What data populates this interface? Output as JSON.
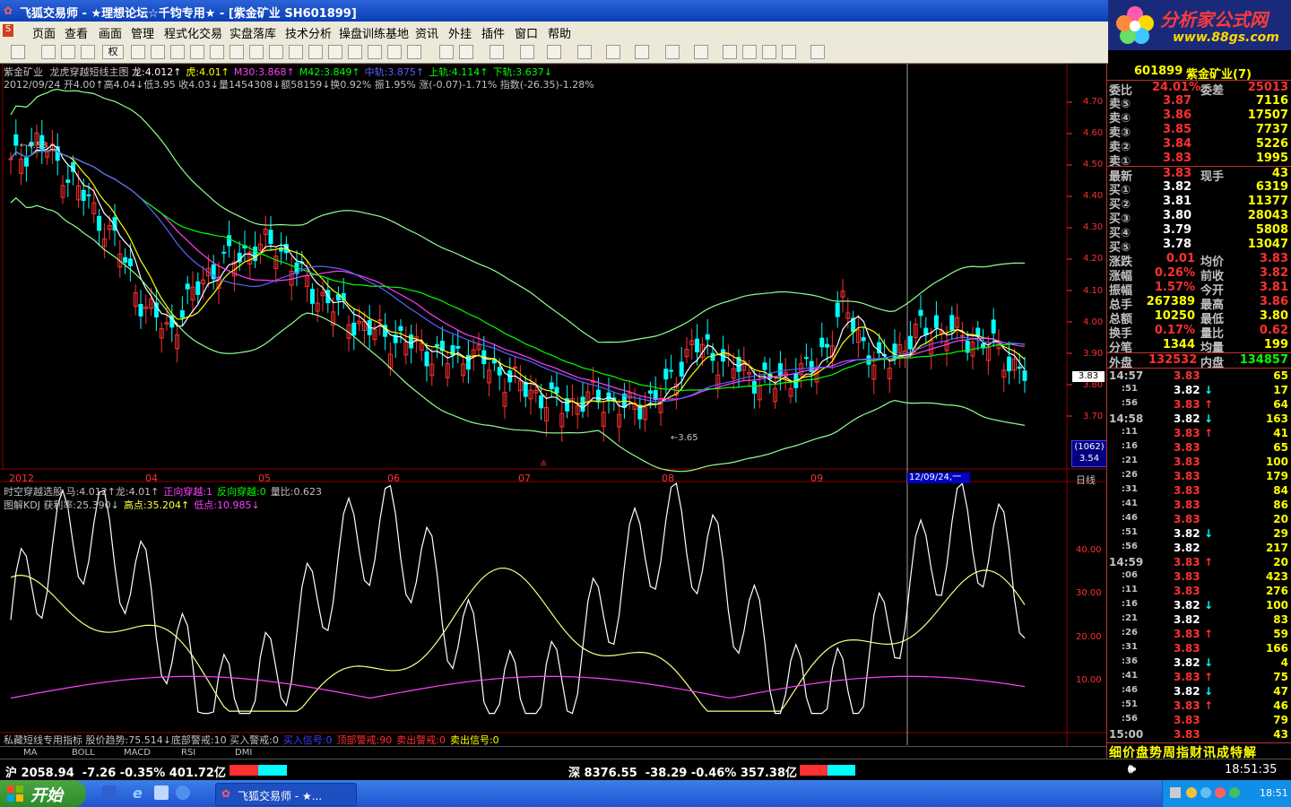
{
  "window": {
    "title": "飞狐交易师 - ★理想论坛☆千钧专用★ - [紫金矿业  SH601899]",
    "logo_text": "分析家公式网",
    "logo_url": "www.88gs.com"
  },
  "menu": [
    "页面",
    "查看",
    "画面",
    "管理",
    "程式化交易",
    "实盘落库",
    "技术分析",
    "操盘训练基地",
    "资讯",
    "外挂",
    "插件",
    "窗口",
    "帮助"
  ],
  "toolbar": {
    "right_mode": "权"
  },
  "chart": {
    "header1": {
      "name": "紫金矿业",
      "indicator": "龙虎穿越短线主图",
      "parts": [
        {
          "text": "龙:4.012↑",
          "color": "#ffffff"
        },
        {
          "text": "虎:4.01↑",
          "color": "#ffff00"
        },
        {
          "text": "M30:3.868↑",
          "color": "#ff40ff"
        },
        {
          "text": "M42:3.849↑",
          "color": "#00ff00"
        },
        {
          "text": "中轨:3.875↑",
          "color": "#6060ff"
        },
        {
          "text": "上轨:4.114↑",
          "color": "#00ff00"
        },
        {
          "text": "下轨:3.637↓",
          "color": "#00ff00"
        }
      ]
    },
    "header2": "2012/09/24 开4.00↑高4.04↓低3.95 收4.03↓量1454308↓额58159↓换0.92% 振1.95% 涨(-0.07)-1.71% 指数(-26.35)-1.28%",
    "price_axis": [
      "4.70",
      "4.60",
      "4.50",
      "4.40",
      "4.30",
      "4.20",
      "4.10",
      "4.00",
      "3.90",
      "3.80",
      "3.70"
    ],
    "current_price_tag": "3.83",
    "high_mark": "4.58",
    "low_mark": "3.65",
    "volume_box": [
      "(1062)",
      "3.54"
    ],
    "date_axis": [
      "2012",
      "04",
      "05",
      "06",
      "07",
      "08",
      "09"
    ],
    "cursor_date": "12/09/24,一",
    "period": "日线",
    "sub_header1": [
      {
        "text": "时空穿越选股  马:4.012↑龙:4.01↑",
        "color": "#c0c0c0"
      },
      {
        "text": "正向穿越:1",
        "color": "#ff40ff"
      },
      {
        "text": "反向穿越:0",
        "color": "#00ff00"
      },
      {
        "text": "量比:0.623",
        "color": "#c0c0c0"
      }
    ],
    "sub_header2": [
      {
        "text": "图解KDJ  获利率:25.390↓",
        "color": "#c0c0c0"
      },
      {
        "text": "高点:35.204↑",
        "color": "#ffff40"
      },
      {
        "text": "低点:10.985↓",
        "color": "#ff40ff"
      }
    ],
    "sub_axis": [
      "40.00",
      "30.00",
      "20.00",
      "10.00"
    ],
    "bottom_header": [
      {
        "text": "私藏短线专用指标  股价趋势:75.514↓底部警戒:10  买入警戒:0",
        "color": "#c0c0c0"
      },
      {
        "text": "买入信号:0",
        "color": "#4040ff"
      },
      {
        "text": "顶部警戒:90",
        "color": "#ff3030"
      },
      {
        "text": "卖出警戒:0",
        "color": "#ff3030"
      },
      {
        "text": "卖出信号:0",
        "color": "#ffff00"
      }
    ],
    "tabs": [
      "MA",
      "BOLL",
      "MACD",
      "RSI",
      "DMI"
    ]
  },
  "quote": {
    "code": "601899",
    "name": "紫金矿业(7)",
    "webi_label": "委比",
    "webi": "24.01%",
    "weicha_label": "委差",
    "weicha": "25013",
    "sells": [
      {
        "label": "卖⑤",
        "price": "3.87",
        "vol": "7116"
      },
      {
        "label": "卖④",
        "price": "3.86",
        "vol": "17507"
      },
      {
        "label": "卖③",
        "price": "3.85",
        "vol": "7737"
      },
      {
        "label": "卖②",
        "price": "3.84",
        "vol": "5226"
      },
      {
        "label": "卖①",
        "price": "3.83",
        "vol": "1995"
      }
    ],
    "latest_label": "最新",
    "latest": "3.83",
    "xianshou_label": "现手",
    "xianshou": "43",
    "buys": [
      {
        "label": "买①",
        "price": "3.82",
        "vol": "6319"
      },
      {
        "label": "买②",
        "price": "3.81",
        "vol": "11377"
      },
      {
        "label": "买③",
        "price": "3.80",
        "vol": "28043"
      },
      {
        "label": "买④",
        "price": "3.79",
        "vol": "5808"
      },
      {
        "label": "买⑤",
        "price": "3.78",
        "vol": "13047"
      }
    ],
    "stats": [
      [
        "涨跌",
        "0.01",
        "均价",
        "3.83"
      ],
      [
        "涨幅",
        "0.26%",
        "前收",
        "3.82"
      ],
      [
        "振幅",
        "1.57%",
        "今开",
        "3.81"
      ],
      [
        "总手",
        "267389",
        "最高",
        "3.86"
      ],
      [
        "总额",
        "10250",
        "最低",
        "3.80"
      ],
      [
        "换手",
        "0.17%",
        "量比",
        "0.62"
      ],
      [
        "分笔",
        "1344",
        "均量",
        "199"
      ]
    ],
    "waipan_label": "外盘",
    "waipan": "132532",
    "neipan_label": "内盘",
    "neipan": "134857",
    "ticks": [
      {
        "t": "14:57",
        "p": "3.83",
        "a": "",
        "v": "65",
        "c": "r"
      },
      {
        "t": ":51",
        "p": "3.82",
        "a": "↓",
        "v": "17",
        "c": "w"
      },
      {
        "t": ":56",
        "p": "3.83",
        "a": "↑",
        "v": "64",
        "c": "r"
      },
      {
        "t": "14:58",
        "p": "3.82",
        "a": "↓",
        "v": "163",
        "c": "w"
      },
      {
        "t": ":11",
        "p": "3.83",
        "a": "↑",
        "v": "41",
        "c": "r"
      },
      {
        "t": ":16",
        "p": "3.83",
        "a": "",
        "v": "65",
        "c": "r"
      },
      {
        "t": ":21",
        "p": "3.83",
        "a": "",
        "v": "100",
        "c": "r"
      },
      {
        "t": ":26",
        "p": "3.83",
        "a": "",
        "v": "179",
        "c": "r"
      },
      {
        "t": ":31",
        "p": "3.83",
        "a": "",
        "v": "84",
        "c": "r"
      },
      {
        "t": ":41",
        "p": "3.83",
        "a": "",
        "v": "86",
        "c": "r"
      },
      {
        "t": ":46",
        "p": "3.83",
        "a": "",
        "v": "20",
        "c": "r"
      },
      {
        "t": ":51",
        "p": "3.82",
        "a": "↓",
        "v": "29",
        "c": "w"
      },
      {
        "t": ":56",
        "p": "3.82",
        "a": "",
        "v": "217",
        "c": "w"
      },
      {
        "t": "14:59",
        "p": "3.83",
        "a": "↑",
        "v": "20",
        "c": "r"
      },
      {
        "t": ":06",
        "p": "3.83",
        "a": "",
        "v": "423",
        "c": "r"
      },
      {
        "t": ":11",
        "p": "3.83",
        "a": "",
        "v": "276",
        "c": "r"
      },
      {
        "t": ":16",
        "p": "3.82",
        "a": "↓",
        "v": "100",
        "c": "w"
      },
      {
        "t": ":21",
        "p": "3.82",
        "a": "",
        "v": "83",
        "c": "w"
      },
      {
        "t": ":26",
        "p": "3.83",
        "a": "↑",
        "v": "59",
        "c": "r"
      },
      {
        "t": ":31",
        "p": "3.83",
        "a": "",
        "v": "166",
        "c": "r"
      },
      {
        "t": ":36",
        "p": "3.82",
        "a": "↓",
        "v": "4",
        "c": "w"
      },
      {
        "t": ":41",
        "p": "3.83",
        "a": "↑",
        "v": "75",
        "c": "r"
      },
      {
        "t": ":46",
        "p": "3.82",
        "a": "↓",
        "v": "47",
        "c": "w"
      },
      {
        "t": ":51",
        "p": "3.83",
        "a": "↑",
        "v": "46",
        "c": "r"
      },
      {
        "t": ":56",
        "p": "3.83",
        "a": "",
        "v": "79",
        "c": "r"
      },
      {
        "t": "15:00",
        "p": "3.83",
        "a": "",
        "v": "43",
        "c": "r"
      }
    ],
    "bottom_tabs": "细价盘势周指财讯成特解"
  },
  "status": {
    "sh": "沪 2058.94  -7.26 -0.35% 401.72亿",
    "sz": "深 8376.55  -38.29 -0.46% 357.38亿",
    "time": "18:51:35"
  },
  "taskbar": {
    "start": "开始",
    "task": "飞狐交易师 - ★...",
    "clock": "18:51"
  },
  "colors": {
    "up": "#ff3030",
    "down": "#00ffff",
    "grid": "#8b0000",
    "background": "#000000"
  }
}
